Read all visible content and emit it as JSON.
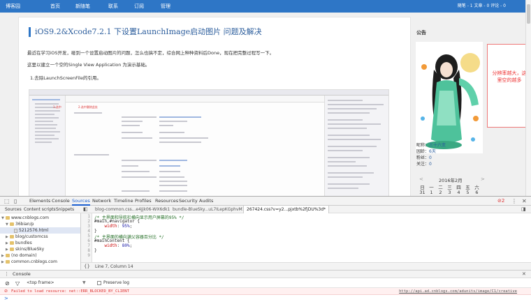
{
  "nav": {
    "items": [
      "博客园",
      "首页",
      "新随笔",
      "联系",
      "订阅",
      "管理"
    ],
    "stats": "随笔 - 1  文章 - 0  评论 - 0"
  },
  "post": {
    "title": "iOS9.2&Xcode7.2.1 下设置LaunchImage启动图片 问题及解决",
    "para1": "最近在学习iOS开发，碰到一个设置启动图片的问题，怎么也搞不定，综合网上种种资料后Done，现在把完整过程写一下。",
    "para2": "这里以建立一个空的Single View Application 为演示基础。",
    "step1": "1.去除LaunchScreenFile的引用。",
    "shot_label1": "1.选中",
    "shot_label2": "2.选中删除此处"
  },
  "sidebar": {
    "title": "公告",
    "nickname_label": "昵称：",
    "nickname": "三十六变",
    "age_label": "园龄：",
    "age": "6天",
    "fans_label": "粉丝：",
    "fans": "0",
    "follow_label": "关注：",
    "follow": "0",
    "calendar_title": "2016年2月",
    "calendar_prev": "<",
    "calendar_next": ">",
    "weekdays": [
      "日",
      "一",
      "二",
      "三",
      "四",
      "五",
      "六"
    ],
    "first_row": [
      "31",
      "1",
      "2",
      "3",
      "4",
      "5",
      "6"
    ]
  },
  "note": {
    "text": "分辨率越大，这里空的越多",
    "color": "#e33333"
  },
  "devtools": {
    "tabs": [
      "Elements",
      "Console",
      "Sources",
      "Network",
      "Timeline",
      "Profiles",
      "Resources",
      "Security",
      "Audits"
    ],
    "active_tab": "Sources",
    "error_count": "2",
    "nav_tabs": [
      "Sources",
      "Content scripts",
      "Snippets"
    ],
    "tree": [
      "www.cnblogs.com",
      "36bian/p",
      "5212576.html",
      "blog/customcss",
      "bundles",
      "skins/BlueSky",
      "(no domain)",
      "common.cnblogs.com"
    ],
    "editor_tabs": [
      "blog-common.css...e4Jjk06-WX6dk1",
      "bundle-BlueSky...uL7ILepKGphvM1*",
      "267424.css?v=y2...pjxtb%2fjDU%3d*"
    ],
    "code_lines": [
      {
        "no": "1",
        "comment": "/* 主界面和导航栏横向显示用户屏幕的95% */"
      },
      {
        "no": "2",
        "selector": "#main,#navigator {"
      },
      {
        "no": "3",
        "prop": "width",
        "value": "95%"
      },
      {
        "no": "4",
        "selector": "}"
      },
      {
        "no": "5",
        "comment": "/* 主界面的横向满父容器百分比 */"
      },
      {
        "no": "6",
        "selector": "#mainContent {"
      },
      {
        "no": "7",
        "prop": "width",
        "value": "80%"
      },
      {
        "no": "8",
        "selector": "}"
      },
      {
        "no": "9",
        "selector": ""
      }
    ],
    "status": "Line 7, Column 14",
    "console_tab": "Console",
    "frame": "<top frame>",
    "preserve_log": "Preserve log",
    "error_msg": "Failed to load resource: net::ERR_BLOCKED_BY_CLIENT",
    "error_url": "http://api.ad.cnblogs.com/adunits/image/C1/creative",
    "prompt": ">"
  }
}
